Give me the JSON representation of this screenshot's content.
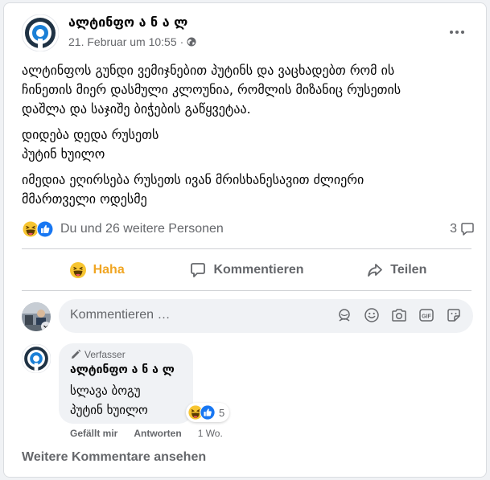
{
  "post": {
    "author": "ალტინფო ა ნ ა ლ",
    "date": "21. Februar um 10:55",
    "separator": "·",
    "privacy_icon": "globe-icon",
    "paragraphs": [
      [
        "ალტინფოს გუნდი ვემიჯნებით პუტინს და ვაცხადებთ რომ ის",
        "ჩინეთის მიერ დასმული კლოუნია, რომლის მიზანიც  რუსეთის",
        "დაშლა და საჯიშე ბიჭების გაწყვეტაა."
      ],
      [
        "დიდება დედა რუსეთს",
        "პუტინ ხუილო"
      ],
      [
        "იმედია ეღირსება რუსეთს ივან მრისხანესავით ძლიერი",
        "მმართველი ოდესმე"
      ]
    ],
    "reactions_text": "Du und 26 weitere Personen",
    "comment_count": "3"
  },
  "actions": {
    "haha": "Haha",
    "comment": "Kommentieren",
    "share": "Teilen"
  },
  "comment_input": {
    "placeholder": "Kommentieren …"
  },
  "comment": {
    "badge": "Verfasser",
    "author": "ალტინფო ა ნ ა ლ",
    "lines": [
      "სლავა ბოგუ",
      "პუტინ ხუილო"
    ],
    "reaction_count": "5",
    "like": "Gefällt mir",
    "reply": "Antworten",
    "time": "1 Wo."
  },
  "more_comments": "Weitere Kommentare ansehen",
  "colors": {
    "haha": "#f0a522",
    "like": "#1877f2",
    "muted": "#65676b",
    "bubble": "#f0f2f5",
    "logo_blue": "#1a7fd6"
  }
}
